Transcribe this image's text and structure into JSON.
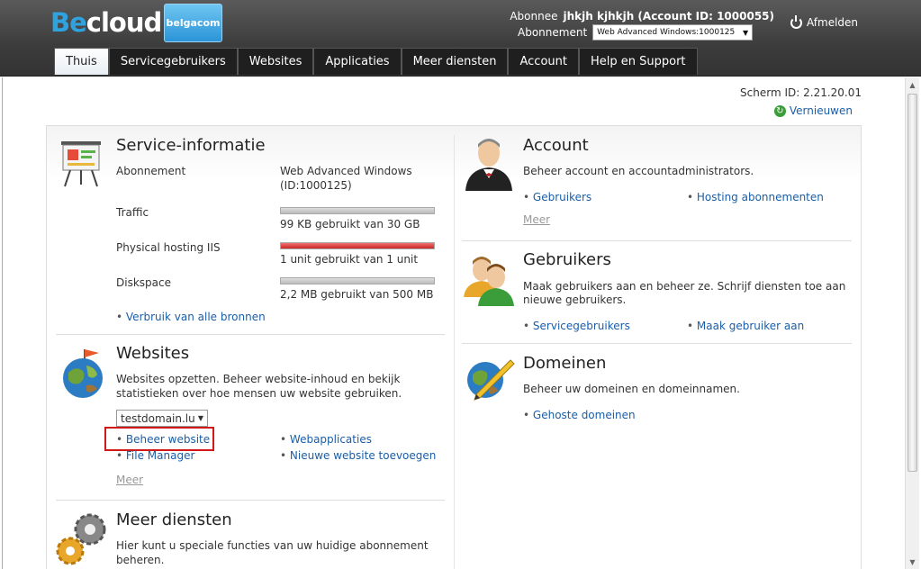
{
  "header": {
    "logo_be": "Be",
    "logo_cloud": "cloud",
    "brand": "belgacom",
    "subscriber_label": "Abonnee",
    "subscriber_value": "jhkjh kjhkjh (Account ID: 1000055)",
    "subscription_label": "Abonnement",
    "subscription_value": "Web Advanced Windows:1000125",
    "logout": "Afmelden"
  },
  "nav": {
    "tabs": [
      "Thuis",
      "Servicegebruikers",
      "Websites",
      "Applicaties",
      "Meer diensten",
      "Account",
      "Help en Support"
    ],
    "active": "Thuis"
  },
  "page": {
    "screen_id": "Scherm ID:  2.21.20.01",
    "refresh": "Vernieuwen"
  },
  "service": {
    "title": "Service-informatie",
    "abonnement_label": "Abonnement",
    "abonnement_value_1": "Web Advanced Windows",
    "abonnement_value_2": "(ID:1000125)",
    "traffic_label": "Traffic",
    "traffic_value": "99 KB gebruikt van 30 GB",
    "traffic_usage": 0.0,
    "iis_label": "Physical hosting IIS",
    "iis_value": "1 unit gebruikt van 1 unit",
    "iis_usage": 1.0,
    "disk_label": "Diskspace",
    "disk_value": "2,2 MB gebruikt van 500 MB",
    "disk_usage": 0.0,
    "all_resources": "Verbruik van alle bronnen"
  },
  "websites": {
    "title": "Websites",
    "desc_1": "Websites opzetten. Beheer website-inhoud en bekijk",
    "desc_2": "statistieken over hoe mensen uw website gebruiken.",
    "domain_select": "testdomain.lu",
    "beheer": "Beheer website",
    "file_manager": "File Manager",
    "webapps": "Webapplicaties",
    "new_site": "Nieuwe website toevoegen",
    "meer": "Meer"
  },
  "meer_diensten": {
    "title": "Meer diensten",
    "desc_1": "Hier kunt u speciale functies van uw huidige abonnement",
    "desc_2": "beheren."
  },
  "account": {
    "title": "Account",
    "desc": "Beheer account en accountadministrators.",
    "link_1": "Gebruikers",
    "link_2": "Hosting abonnementen",
    "meer": "Meer"
  },
  "gebruikers": {
    "title": "Gebruikers",
    "desc_1": "Maak gebruikers aan en beheer ze. Schrijf diensten toe aan",
    "desc_2": "nieuwe gebruikers.",
    "link_1": "Servicegebruikers",
    "link_2": "Maak gebruiker aan"
  },
  "domeinen": {
    "title": "Domeinen",
    "desc": "Beheer uw domeinen en domeinnamen.",
    "link_1": "Gehoste domeinen"
  },
  "colors": {
    "link": "#1a5ea8",
    "header": "#3c3c3c",
    "highlight": "#d01818"
  }
}
